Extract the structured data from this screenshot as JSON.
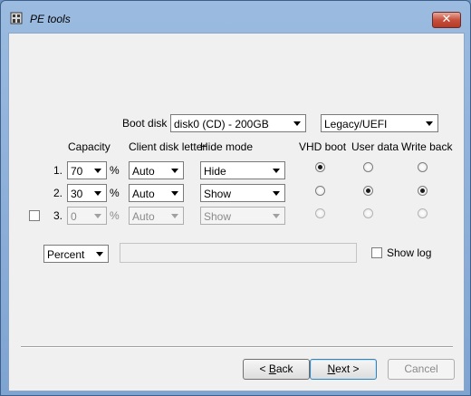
{
  "window": {
    "title": "PE tools",
    "close_glyph": "✕"
  },
  "boot_disk": {
    "label": "Boot disk",
    "value": "disk0 (CD) - 200GB",
    "mode": "Legacy/UEFI"
  },
  "headers": {
    "capacity": "Capacity",
    "client_letter": "Client disk letter",
    "hide_mode": "Hide mode",
    "vhd_boot": "VHD boot",
    "user_data": "User data",
    "write_back": "Write back"
  },
  "rows": [
    {
      "number": "1.",
      "capacity": "70",
      "percent": "%",
      "letter": "Auto",
      "hide": "Hide",
      "vhd_boot": true,
      "user_data": false,
      "write_back": false,
      "enabled": true
    },
    {
      "number": "2.",
      "capacity": "30",
      "percent": "%",
      "letter": "Auto",
      "hide": "Show",
      "vhd_boot": false,
      "user_data": true,
      "write_back": true,
      "enabled": true
    },
    {
      "number": "3.",
      "capacity": "0",
      "percent": "%",
      "letter": "Auto",
      "hide": "Show",
      "vhd_boot": false,
      "user_data": false,
      "write_back": false,
      "enabled": false,
      "checked": false
    }
  ],
  "unit": {
    "value": "Percent"
  },
  "show_log": {
    "label": "Show log",
    "checked": false
  },
  "buttons": {
    "back_prefix": "< ",
    "back_key": "B",
    "back_rest": "ack",
    "next_key": "N",
    "next_rest": "ext >",
    "cancel": "Cancel"
  }
}
